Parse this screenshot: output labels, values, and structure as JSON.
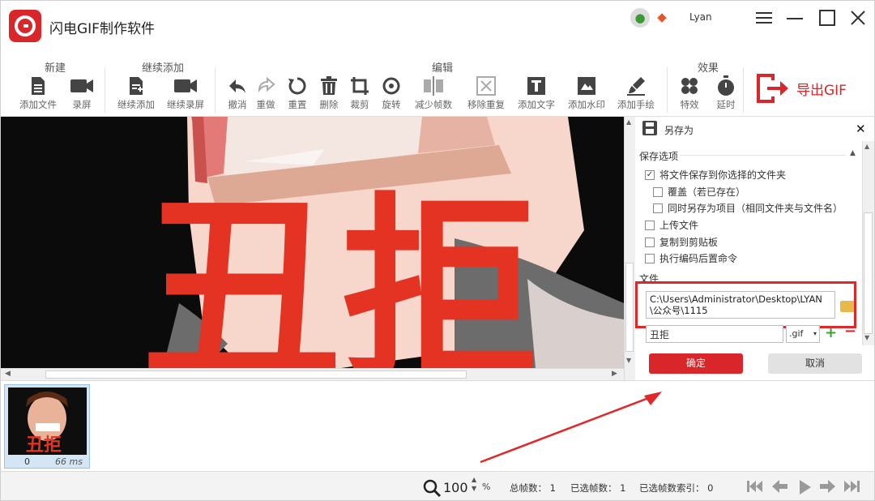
{
  "app": {
    "title": "闪电GIF制作软件",
    "username": "Lyan"
  },
  "toolbar": {
    "groups": {
      "new": "新建",
      "continue": "继续添加",
      "edit": "编辑",
      "effects": "效果"
    },
    "buttons": {
      "add_file": "添加文件",
      "record": "录屏",
      "continue_add": "继续添加",
      "continue_record": "继续录屏",
      "undo": "撤消",
      "redo": "重做",
      "reset": "重置",
      "delete": "删除",
      "crop": "裁剪",
      "rotate": "旋转",
      "reduce_frames": "减少帧数",
      "remove_dup": "移除重复",
      "add_text": "添加文字",
      "add_watermark": "添加水印",
      "add_drawing": "添加手绘",
      "effects": "特效",
      "delay": "延时"
    },
    "export_label": "导出GIF",
    "accent": "#d9262b"
  },
  "canvas": {
    "overlay_text": "丑拒"
  },
  "save_panel": {
    "title": "另存为",
    "options_header": "保存选项",
    "options": [
      {
        "label": "将文件保存到你选择的文件夹",
        "checked": true
      },
      {
        "label": "覆盖（若已存在）",
        "checked": false
      },
      {
        "label": "同时另存为项目（相同文件夹与文件名）",
        "checked": false
      },
      {
        "label": "上传文件",
        "checked": false
      },
      {
        "label": "复制到剪贴板",
        "checked": false
      },
      {
        "label": "执行编码后置命令",
        "checked": false
      }
    ],
    "file_header": "文件",
    "path_line1": "C:\\Users\\Administrator\\Desktop\\LYAN",
    "path_line2": "\\公众号\\1115",
    "filename": "丑拒",
    "extension": ".gif",
    "ok": "确定",
    "cancel": "取消"
  },
  "frames": [
    {
      "index": "0",
      "duration": "66 ms",
      "caption": "丑拒"
    }
  ],
  "status": {
    "zoom": "100",
    "zoom_unit": "%",
    "total_frames": "总帧数： 1",
    "selected_frames": "已选帧数： 1",
    "selected_index": "已选帧数索引： 0"
  }
}
